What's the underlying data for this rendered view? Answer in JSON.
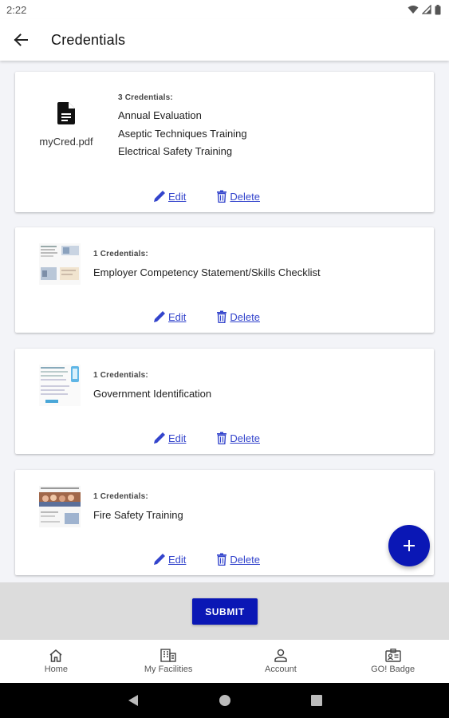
{
  "status_bar": {
    "time": "2:22"
  },
  "app_bar": {
    "title": "Credentials"
  },
  "cards": [
    {
      "file_name": "myCred.pdf",
      "count_label": "3 Credentials:",
      "items": [
        "Annual Evaluation",
        "Aseptic Techniques Training",
        "Electrical Safety Training"
      ],
      "edit_label": "Edit",
      "delete_label": "Delete"
    },
    {
      "count_label": "1 Credentials:",
      "items": [
        "Employer Competency Statement/Skills Checklist"
      ],
      "edit_label": "Edit",
      "delete_label": "Delete"
    },
    {
      "count_label": "1 Credentials:",
      "items": [
        "Government Identification"
      ],
      "edit_label": "Edit",
      "delete_label": "Delete"
    },
    {
      "count_label": "1 Credentials:",
      "items": [
        "Fire Safety Training"
      ],
      "edit_label": "Edit",
      "delete_label": "Delete"
    }
  ],
  "submit_label": "SUBMIT",
  "bottom_nav": [
    {
      "label": "Home",
      "icon": "home-icon"
    },
    {
      "label": "My Facilities",
      "icon": "facilities-icon"
    },
    {
      "label": "Account",
      "icon": "account-icon"
    },
    {
      "label": "GO! Badge",
      "icon": "badge-icon"
    }
  ],
  "colors": {
    "primary": "#0a17b5",
    "link": "#3344cc",
    "background": "#f3f4f8"
  }
}
